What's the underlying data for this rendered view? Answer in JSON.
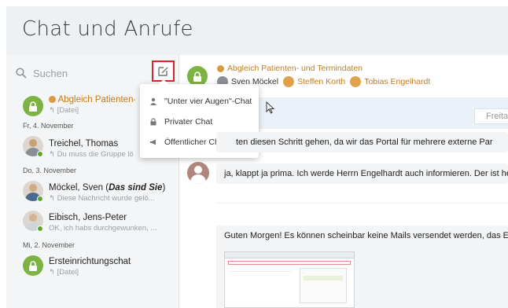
{
  "app": {
    "title": "Chat und Anrufe"
  },
  "search": {
    "placeholder": "Suchen"
  },
  "menu": {
    "private_one_on_one": "\"Unter vier Augen\"-Chat",
    "private_chat": "Privater Chat",
    "public_chat": "Öffentlicher Chat"
  },
  "conversations": [
    {
      "name": "Abgleich Patienten- u",
      "sub": "[Datei]"
    },
    {
      "date": "Fr, 4. November",
      "name": "Treichel, Thomas",
      "sub": "Du muss die Gruppe lö"
    },
    {
      "date": "Do, 3. November",
      "name": "Möckel, Sven (",
      "name_em": "Das sind Sie",
      "name_end": ")",
      "sub": "Diese Nachricht wurde gelö..."
    },
    {
      "name": "Eibisch, Jens-Peter",
      "sub": "OK, ich habs durchgewunken, ..."
    },
    {
      "date": "Mi, 2. November",
      "name": "Ersteinrichtungschat",
      "sub": "[Datei]"
    }
  ],
  "chat": {
    "title": "Abgleich Patienten- und Termindaten",
    "members": [
      "Sven Möckel",
      "Steffen Korth",
      "Tobias Engelhardt"
    ],
    "day_label": "Freita",
    "messages": [
      "ten diesen Schritt gehen, da wir das Portal für mehrere externe Par",
      "ja, klappt ja prima. Ich werde Herrn Engelhardt auch informieren. Der ist heu",
      "Guten Morgen! Es können scheinbar keine Mails versendet werden, das Eve"
    ]
  },
  "colors": {
    "accent_green": "#7cb342",
    "member_orange": "#c47c1b",
    "highlight_red": "#d9252b"
  }
}
